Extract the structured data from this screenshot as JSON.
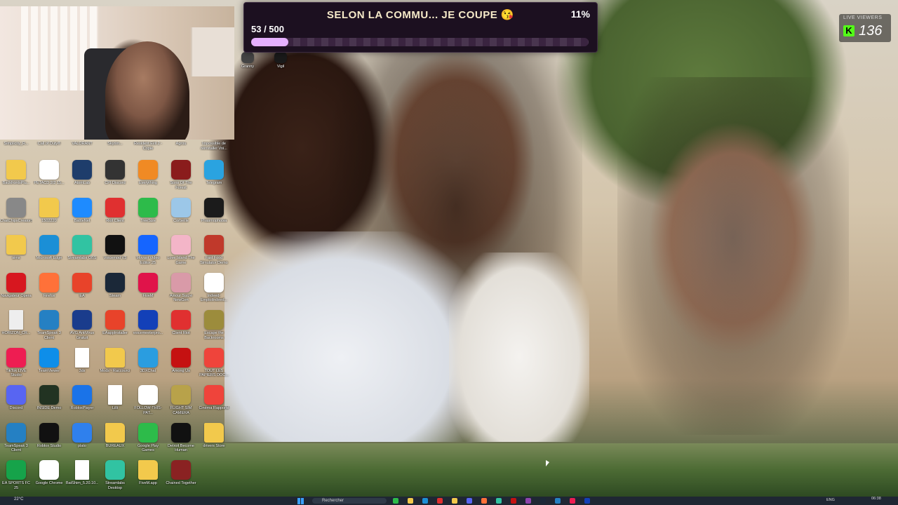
{
  "event": {
    "title": "SELON LA COMMU... JE COUPE 😘",
    "count": "53 / 500",
    "percent_label": "11%",
    "progress": 0.11,
    "accent": "#e6b0ff"
  },
  "viewers": {
    "label": "LIVE VIEWERS",
    "platform_icon": "K",
    "count": "136"
  },
  "desktop": {
    "top_row": [
      {
        "label": "Simplicity_R...",
        "icon": "app-icon"
      },
      {
        "label": "Call of Duty®",
        "icon": "cod-icon"
      },
      {
        "label": "VALORANT",
        "icon": "valorant-icon"
      },
      {
        "label": "Skyrim...",
        "icon": "app-icon"
      },
      {
        "label": "Resident Evil 2 - Copie",
        "icon": "re2-icon"
      },
      {
        "label": "Agrou",
        "icon": "app-icon"
      },
      {
        "label": "Impossible de réinstaller Voi...",
        "icon": "file-icon"
      }
    ],
    "small_top": [
      {
        "label": "Granny",
        "icon": "granny-icon"
      },
      {
        "label": "Vigil",
        "icon": "vigil-icon"
      }
    ],
    "icons": [
      {
        "label": "BackfrontsPlu...",
        "icon": "folder-icon",
        "color": "#f2c94c"
      },
      {
        "label": "PETACD 2/2 15...",
        "icon": "chrome-icon",
        "color": "#ffffff"
      },
      {
        "label": "AtomLab",
        "icon": "atom-icon",
        "color": "#1e3d6b"
      },
      {
        "label": "CPI Discord",
        "icon": "doc-icon",
        "color": "#333333"
      },
      {
        "label": "Everything",
        "icon": "everything-icon",
        "color": "#f08a24"
      },
      {
        "label": "Sons Of The Forest",
        "icon": "sotf-icon",
        "color": "#8a1c1c"
      },
      {
        "label": "Telegram",
        "icon": "telegram-icon",
        "color": "#2aa3e0"
      },
      {
        "label": "ChatChipsCreatorStudio",
        "icon": "creator-icon",
        "color": "#888888"
      },
      {
        "label": "1502220",
        "icon": "folder-icon",
        "color": "#f2c94c"
      },
      {
        "label": "BattleNet",
        "icon": "battlenet-icon",
        "color": "#1e8bff"
      },
      {
        "label": "Riot Client",
        "icon": "riot-icon",
        "color": "#e03030"
      },
      {
        "label": "TreeSize",
        "icon": "treesize-icon",
        "color": "#2dbb4a"
      },
      {
        "label": "Corbeille",
        "icon": "trash-icon",
        "color": "#9cc7e8"
      },
      {
        "label": "Phasmophobia",
        "icon": "phasmo-icon",
        "color": "#1b1b1b"
      },
      {
        "label": "sims",
        "icon": "folder-icon",
        "color": "#f2c94c"
      },
      {
        "label": "Microsoft Edge",
        "icon": "edge-icon",
        "color": "#1b8fd6"
      },
      {
        "label": "Streamlabs OBS",
        "icon": "obs-icon",
        "color": "#31c3a2"
      },
      {
        "label": "Voicemod V3",
        "icon": "voicemod-icon",
        "color": "#111111"
      },
      {
        "label": "Movavi Video Editor 25",
        "icon": "movavi-icon",
        "color": "#1565ff"
      },
      {
        "label": "Love Island The Game",
        "icon": "loveisland-icon",
        "color": "#f3b5c8"
      },
      {
        "label": "Fast Food Simulator Demo",
        "icon": "fastfood-icon",
        "color": "#c0392b"
      },
      {
        "label": "Navigateur Opera",
        "icon": "opera-icon",
        "color": "#d7171f"
      },
      {
        "label": "Firefox",
        "icon": "firefox-icon",
        "color": "#ff7139"
      },
      {
        "label": "EA",
        "icon": "ea-icon",
        "color": "#e8432a"
      },
      {
        "label": "Steam",
        "icon": "steam-icon",
        "color": "#1b2838"
      },
      {
        "label": "FiveM",
        "icon": "fivem-icon",
        "color": "#e0134a"
      },
      {
        "label": "Amour Sucré NewGen",
        "icon": "amoursucre-icon",
        "color": "#d99aa8"
      },
      {
        "label": "Indeed-EmploiIndeed...",
        "icon": "chrome-icon",
        "color": "#ffffff"
      },
      {
        "label": "HORIZON_CR...",
        "icon": "file-icon",
        "color": "#eeeeee"
      },
      {
        "label": "TeamSpeak 3 Client",
        "icon": "teamspeak-icon",
        "color": "#2580c3"
      },
      {
        "label": "AVG AntiVirus Gratuit",
        "icon": "avg-icon",
        "color": "#1a3c8c"
      },
      {
        "label": "EAappInstaller",
        "icon": "ea-icon",
        "color": "#e8432a"
      },
      {
        "label": "voicemeeterpro...",
        "icon": "voicemeeter-icon",
        "color": "#1340b8"
      },
      {
        "label": "Client Riot",
        "icon": "riot-icon",
        "color": "#e03030"
      },
      {
        "label": "Escape the Backrooms",
        "icon": "backrooms-icon",
        "color": "#9c8c3c"
      },
      {
        "label": "TikTok LIVE Studio",
        "icon": "tiktok-icon",
        "color": "#ee1d52"
      },
      {
        "label": "TeamViewer",
        "icon": "teamviewer-icon",
        "color": "#0e8ee9"
      },
      {
        "label": "3ds",
        "icon": "file-icon",
        "color": "#ffffff"
      },
      {
        "label": "Mods - Raccourci",
        "icon": "folder-icon",
        "color": "#f2c94c"
      },
      {
        "label": "3DXChat",
        "icon": "chat-icon",
        "color": "#2a9de0"
      },
      {
        "label": "Among Us",
        "icon": "amongus-icon",
        "color": "#c51111"
      },
      {
        "label": "TOUT LES PAPIERS DOC...",
        "icon": "anydesk-icon",
        "color": "#ef443b"
      },
      {
        "label": "Discord",
        "icon": "discord-icon",
        "color": "#5865f2"
      },
      {
        "label": "INSIDE Demo",
        "icon": "inside-icon",
        "color": "#223322"
      },
      {
        "label": "RobloxPlayer",
        "icon": "roblox-icon",
        "color": "#1a73e8"
      },
      {
        "label": "Lilli",
        "icon": "file-icon",
        "color": "#ffffff"
      },
      {
        "label": "FOLLOW-THIS-PAT...",
        "icon": "chrome-icon",
        "color": "#ffffff"
      },
      {
        "label": "FLIGHT SIM CAMERA",
        "icon": "game-icon",
        "color": "#b8a24a"
      },
      {
        "label": "Cinéma Rapporté",
        "icon": "anydesk-icon",
        "color": "#ef443b"
      },
      {
        "label": "TeamSpeak 3 Client",
        "icon": "teamspeak-icon",
        "color": "#2580c3"
      },
      {
        "label": "Roblox Studio",
        "icon": "robloxstudio-icon",
        "color": "#111111"
      },
      {
        "label": "plato",
        "icon": "plato-icon",
        "color": "#2f80ed"
      },
      {
        "label": "BUREAUX",
        "icon": "folder-icon",
        "color": "#f2c94c"
      },
      {
        "label": "Google Play Games",
        "icon": "playgames-icon",
        "color": "#2dbb4a"
      },
      {
        "label": "Detroit Become Human",
        "icon": "detroit-icon",
        "color": "#111111"
      },
      {
        "label": "drivers Store",
        "icon": "folder-icon",
        "color": "#f2c94c"
      },
      {
        "label": "EA SPORTS FC 25",
        "icon": "fc25-icon",
        "color": "#16a34a"
      },
      {
        "label": "Google Chrome",
        "icon": "chrome-icon",
        "color": "#ffffff"
      },
      {
        "label": "BatShim_5.20.10...",
        "icon": "file-icon",
        "color": "#ffffff"
      },
      {
        "label": "Streamlabs Desktop",
        "icon": "streamlabs-icon",
        "color": "#31c3a2"
      },
      {
        "label": "FiveM.app",
        "icon": "folder-icon",
        "color": "#f2c94c"
      },
      {
        "label": "Chained Together",
        "icon": "chained-icon",
        "color": "#8a2222"
      }
    ]
  },
  "taskbar": {
    "weather": "22°C",
    "search_placeholder": "Rechercher",
    "language": "ENG",
    "time": "06:38",
    "date": "..."
  }
}
